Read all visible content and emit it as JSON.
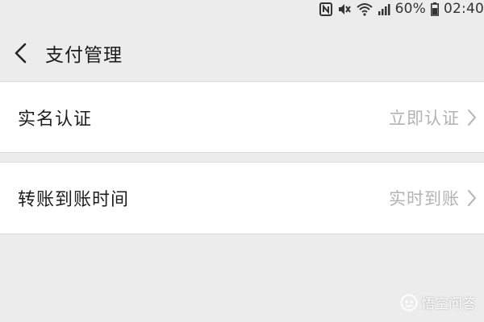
{
  "status_bar": {
    "battery": "60%",
    "time": "02:40",
    "icons": [
      "nfc-icon",
      "mute-icon",
      "wifi-icon",
      "signal-icon",
      "battery-icon"
    ]
  },
  "header": {
    "title": "支付管理",
    "back_icon": "chevron-left-icon"
  },
  "settings": {
    "items": [
      {
        "label": "实名认证",
        "value": "立即认证"
      },
      {
        "label": "转账到账时间",
        "value": "实时到账"
      }
    ]
  },
  "watermark": {
    "text": "悟空问答",
    "icon": "toutiao-logo-icon"
  },
  "colors": {
    "background": "#ececec",
    "card": "#ffffff",
    "muted_text": "#b3b3b3",
    "primary_text": "#1d1d1d"
  }
}
